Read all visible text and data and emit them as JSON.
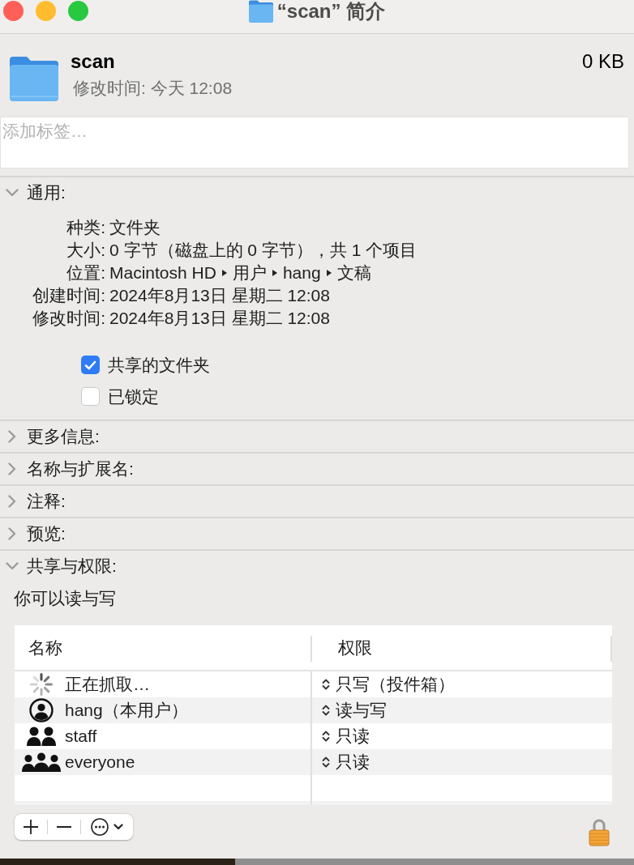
{
  "window": {
    "title": "“scan” 简介"
  },
  "header": {
    "name": "scan",
    "size": "0 KB",
    "modified": "修改时间: 今天 12:08"
  },
  "tags": {
    "placeholder": "添加标签…"
  },
  "sections": [
    {
      "title": "通用:",
      "expanded": true,
      "info": [
        {
          "kind": "text",
          "label": "种类:",
          "value": "文件夹"
        },
        {
          "kind": "text",
          "label": "大小:",
          "value": "0 字节（磁盘上的 0 字节），共 1 个项目"
        },
        {
          "kind": "path",
          "label": "位置:",
          "path": [
            "Macintosh HD",
            "用户",
            "hang",
            "文稿"
          ]
        },
        {
          "kind": "text",
          "label": "创建时间:",
          "value": "2024年8月13日 星期二 12:08"
        },
        {
          "kind": "text",
          "label": "修改时间:",
          "value": "2024年8月13日 星期二 12:08"
        }
      ],
      "checkboxes": [
        {
          "label": "共享的文件夹",
          "checked": true
        },
        {
          "label": "已锁定",
          "checked": false
        }
      ]
    },
    {
      "title": "更多信息:",
      "expanded": false
    },
    {
      "title": "名称与扩展名:",
      "expanded": false
    },
    {
      "title": "注释:",
      "expanded": false
    },
    {
      "title": "预览:",
      "expanded": false
    },
    {
      "title": "共享与权限:",
      "expanded": true,
      "access": "你可以读与写",
      "table": {
        "columns": [
          "名称",
          "权限"
        ],
        "rows": [
          {
            "kind": "loading",
            "name": "正在抓取…",
            "privilege": "只写（投件箱）"
          },
          {
            "kind": "user",
            "name": "hang（本用户）",
            "privilege": "读与写"
          },
          {
            "kind": "group",
            "name": "staff",
            "privilege": "只读"
          },
          {
            "kind": "everyone",
            "name": "everyone",
            "privilege": "只读"
          }
        ]
      }
    }
  ],
  "lock": {
    "locked": true
  }
}
